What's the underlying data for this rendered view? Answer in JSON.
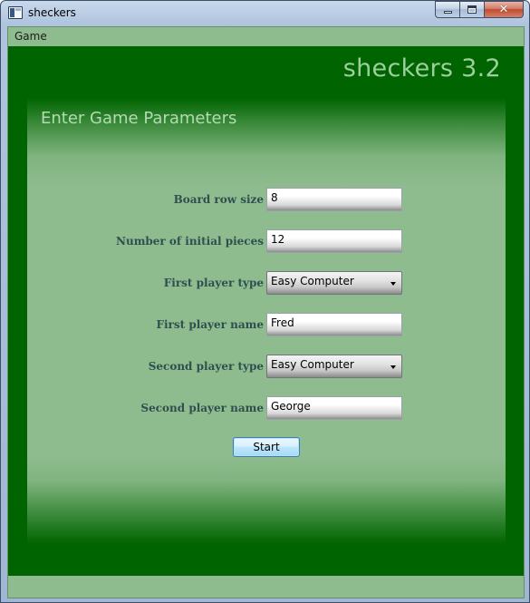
{
  "window": {
    "title": "sheckers",
    "caption": {
      "minimize": "",
      "maximize": "",
      "close": "✕"
    }
  },
  "menu": {
    "items": [
      "Game"
    ]
  },
  "app": {
    "title": "sheckers 3.2"
  },
  "form": {
    "heading": "Enter Game Parameters",
    "fields": [
      {
        "label": "Board row size",
        "value": "8",
        "type": "text"
      },
      {
        "label": "Number of initial pieces",
        "value": "12",
        "type": "text"
      },
      {
        "label": "First player type",
        "value": "Easy Computer",
        "type": "select"
      },
      {
        "label": "First player name",
        "value": "Fred",
        "type": "text"
      },
      {
        "label": "Second player type",
        "value": "Easy Computer",
        "type": "select"
      },
      {
        "label": "Second player name",
        "value": "George",
        "type": "text"
      }
    ],
    "start_label": "Start"
  },
  "colors": {
    "main_background": "#006400",
    "panel_light": "#8FBC8F",
    "label_text": "#2F4F4F",
    "title_text": "#9CCF9C"
  },
  "icons": {
    "app": "app-window-icon",
    "minimize": "minimize-icon",
    "maximize": "maximize-icon",
    "close": "close-icon",
    "dropdown": "chevron-down-icon"
  }
}
